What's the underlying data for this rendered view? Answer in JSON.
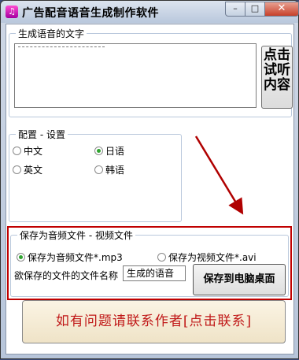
{
  "window": {
    "title": "广告配音语音生成制作软件",
    "icon_glyph": "♫",
    "min_symbol": "–",
    "max_symbol": "□",
    "close_symbol": "✕"
  },
  "speech_text": {
    "group_title": "生成语音的文字",
    "text_value": "",
    "preview_button": "点击试听内容"
  },
  "config": {
    "group_title": "配置 - 设置",
    "languages": [
      {
        "label": "中文",
        "selected": false
      },
      {
        "label": "日语",
        "selected": true
      },
      {
        "label": "英文",
        "selected": false
      },
      {
        "label": "韩语",
        "selected": false
      }
    ]
  },
  "save": {
    "group_title": "保存为音频文件 - 视频文件",
    "option_audio": "保存为音频文件*.mp3",
    "option_video": "保存为视频文件*.avi",
    "audio_selected": true,
    "video_selected": false,
    "filename_label": "欲保存的文件的文件名称",
    "filename_value": "生成的语音",
    "save_button": "保存到电脑桌面"
  },
  "contact_button": "如有问题请联系作者[点击联系]",
  "colors": {
    "highlight_box": "#c00000",
    "arrow": "#b00000",
    "contact_text": "#c01818"
  }
}
